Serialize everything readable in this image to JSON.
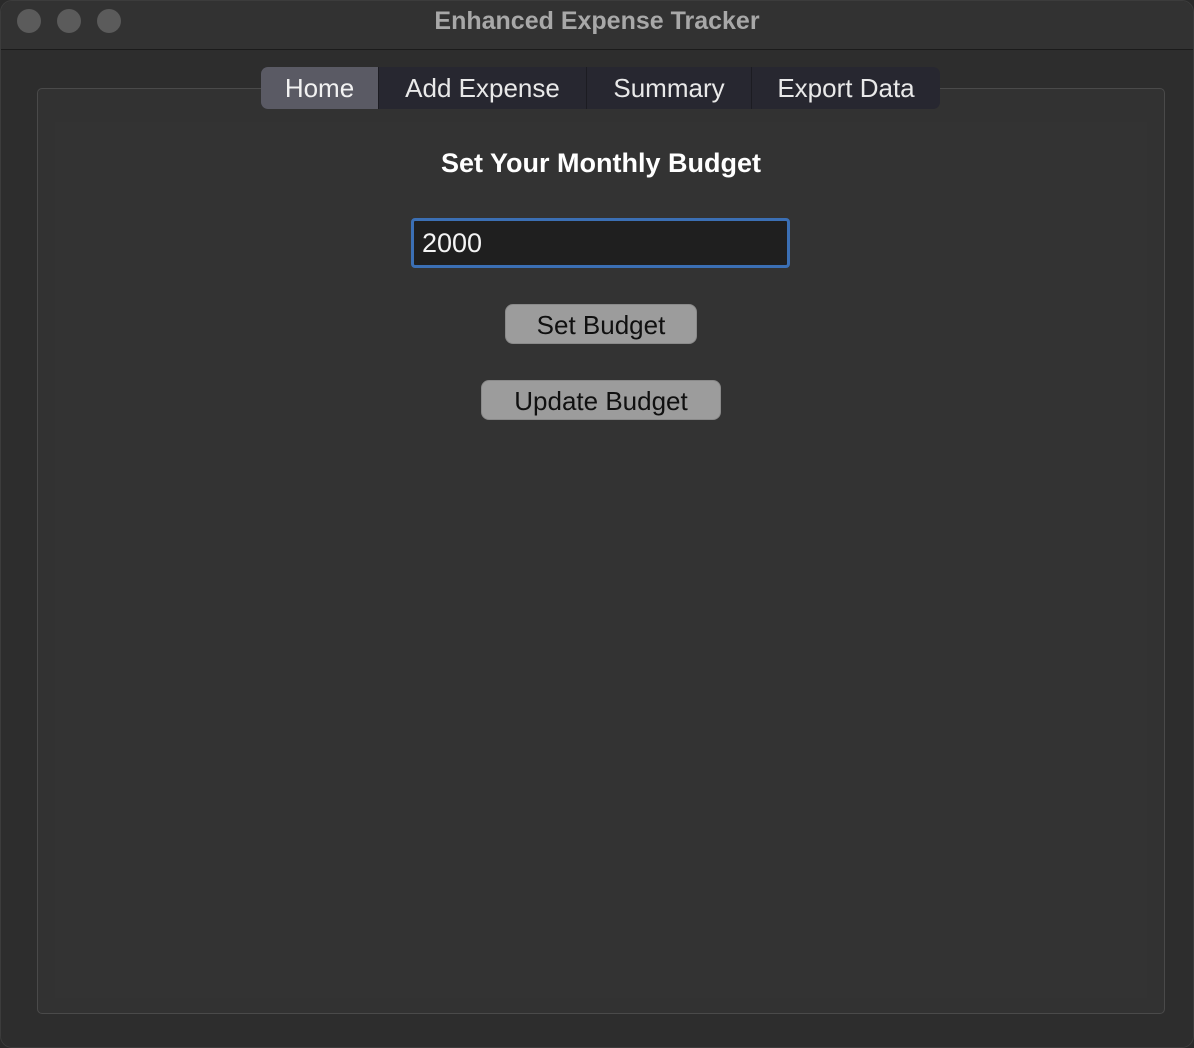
{
  "window": {
    "title": "Enhanced Expense Tracker"
  },
  "tabs": [
    {
      "label": "Home",
      "active": true
    },
    {
      "label": "Add Expense",
      "active": false
    },
    {
      "label": "Summary",
      "active": false
    },
    {
      "label": "Export Data",
      "active": false
    }
  ],
  "home": {
    "heading": "Set Your Monthly Budget",
    "budget_value": "2000",
    "set_button_label": "Set Budget",
    "update_button_label": "Update Budget"
  },
  "colors": {
    "focus_ring": "#3b6fb4",
    "active_tab": "#5a5a64",
    "button": "#9c9c9c"
  }
}
